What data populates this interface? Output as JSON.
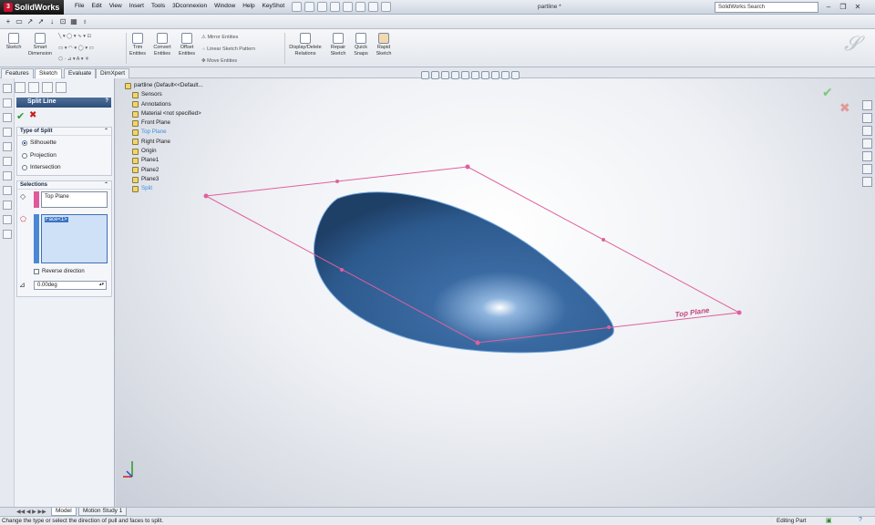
{
  "app": {
    "name": "SolidWorks",
    "doc_title": "partline *"
  },
  "menu": [
    "File",
    "Edit",
    "View",
    "Insert",
    "Tools",
    "3Dconnexion",
    "Window",
    "Help",
    "KeyShot"
  ],
  "search": {
    "placeholder": "SolidWorks Search"
  },
  "command_manager": {
    "sketch": "Sketch",
    "smart_dimension_1": "Smart",
    "smart_dimension_2": "Dimension",
    "trim_1": "Trim",
    "trim_2": "Entities",
    "convert_1": "Convert",
    "convert_2": "Entities",
    "offset_1": "Offset",
    "offset_2": "Entities",
    "mirror": "Mirror Entities",
    "linear_pattern": "Linear Sketch Pattern",
    "move": "Move Entities",
    "display_delete_1": "Display/Delete",
    "display_delete_2": "Relations",
    "repair_1": "Repair",
    "repair_2": "Sketch",
    "quick_snaps_1": "Quick",
    "quick_snaps_2": "Snaps",
    "rapid_1": "Rapid",
    "rapid_2": "Sketch"
  },
  "tabs": [
    "Features",
    "Sketch",
    "Evaluate",
    "DimXpert"
  ],
  "active_tab": "Sketch",
  "property_manager": {
    "title": "Split Line",
    "help": "?",
    "type_group": "Type of Split",
    "options": [
      "Silhouette",
      "Projection",
      "Intersection"
    ],
    "selected_option": "Silhouette",
    "selections_group": "Selections",
    "plane_value": "Top Plane",
    "face_value": "Face<1>",
    "reverse_direction": "Reverse direction",
    "angle": "0.00deg",
    "accent_plane": "#e05a9a",
    "accent_face": "#4a88d6"
  },
  "feature_tree": {
    "root": "partline (Default<<Default...",
    "items": [
      "Sensors",
      "Annotations",
      "Material <not specified>",
      "Front Plane",
      "Top Plane",
      "Right Plane",
      "Origin",
      "Plane1",
      "Plane2",
      "Plane3",
      "Split"
    ],
    "selected": "Top Plane"
  },
  "model": {
    "part_color": "#2f5f94",
    "plane_color": "#e0609c",
    "plane_label": "Top Plane"
  },
  "bottom_tabs": [
    "Model",
    "Motion Study 1"
  ],
  "active_bottom_tab": "Model",
  "status": {
    "message": "Change the type or select the direction of pull and faces to split.",
    "mode": "Editing Part",
    "help": "?"
  }
}
